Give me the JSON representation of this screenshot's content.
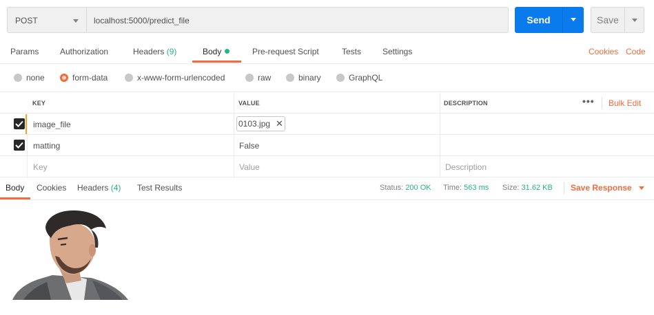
{
  "request": {
    "method": "POST",
    "url": "localhost:5000/predict_file",
    "send_label": "Send",
    "save_label": "Save"
  },
  "request_tabs": [
    {
      "label": "Params"
    },
    {
      "label": "Authorization"
    },
    {
      "label": "Headers",
      "count": "(9)"
    },
    {
      "label": "Body"
    },
    {
      "label": "Pre-request Script"
    },
    {
      "label": "Tests"
    },
    {
      "label": "Settings"
    }
  ],
  "links": {
    "cookies": "Cookies",
    "code": "Code"
  },
  "body_types": [
    {
      "label": "none",
      "selected": false
    },
    {
      "label": "form-data",
      "selected": true
    },
    {
      "label": "x-www-form-urlencoded",
      "selected": false
    },
    {
      "label": "raw",
      "selected": false
    },
    {
      "label": "binary",
      "selected": false
    },
    {
      "label": "GraphQL",
      "selected": false
    }
  ],
  "params_table": {
    "headers": {
      "key": "KEY",
      "value": "VALUE",
      "description": "DESCRIPTION"
    },
    "more_icon": "ellipsis-icon",
    "bulk_edit": "Bulk Edit",
    "rows": [
      {
        "checked": true,
        "key": "image_file",
        "value": "0103.jpg",
        "value_type": "file"
      },
      {
        "checked": true,
        "key": "matting",
        "value": "False",
        "value_type": "text"
      }
    ],
    "placeholders": {
      "key": "Key",
      "value": "Value",
      "description": "Description"
    }
  },
  "response_tabs": [
    {
      "label": "Body"
    },
    {
      "label": "Cookies"
    },
    {
      "label": "Headers",
      "count": "(4)"
    },
    {
      "label": "Test Results"
    }
  ],
  "response_status": {
    "status_label": "Status:",
    "status_value": "200 OK",
    "time_label": "Time:",
    "time_value": "563 ms",
    "size_label": "Size:",
    "size_value": "31.62 KB"
  },
  "save_response": "Save Response",
  "colors": {
    "accent": "#f26b3a",
    "send_blue": "#097bed",
    "success_green": "#26b47f"
  }
}
